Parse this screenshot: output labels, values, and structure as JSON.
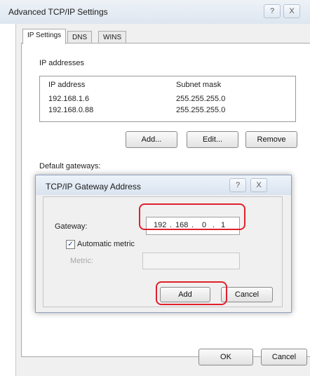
{
  "outer_window": {
    "title": "Advanced TCP/IP Settings",
    "help_glyph": "?",
    "close_glyph": "X"
  },
  "tabs": [
    {
      "label": "IP Settings",
      "active": true
    },
    {
      "label": "DNS",
      "active": false
    },
    {
      "label": "WINS",
      "active": false
    }
  ],
  "ip_section": {
    "title": "IP addresses",
    "columns": [
      "IP address",
      "Subnet mask"
    ],
    "rows": [
      {
        "ip": "192.168.1.6",
        "mask": "255.255.255.0"
      },
      {
        "ip": "192.168.0.88",
        "mask": "255.255.255.0"
      }
    ],
    "buttons": {
      "add": "Add...",
      "edit": "Edit...",
      "remove": "Remove"
    }
  },
  "gateway_section": {
    "title": "Default gateways:"
  },
  "gateway_dialog": {
    "title": "TCP/IP Gateway Address",
    "help_glyph": "?",
    "close_glyph": "X",
    "gateway_label": "Gateway:",
    "gateway_octets": [
      "192",
      "168",
      "0",
      "1"
    ],
    "automatic_metric_label": "Automatic metric",
    "automatic_metric_checked": true,
    "metric_label": "Metric:",
    "metric_value": "",
    "add_button": "Add",
    "cancel_button": "Cancel"
  },
  "footer": {
    "ok_button": "OK",
    "cancel_button": "Cancel"
  },
  "colors": {
    "highlight": "#e0202a",
    "dialog_border": "#8ea2bc"
  }
}
